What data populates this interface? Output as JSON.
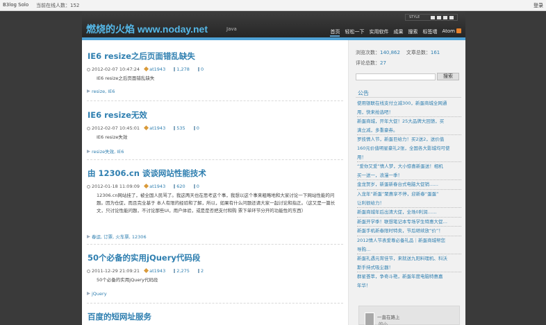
{
  "topbar": {
    "brand": "B3log Solo",
    "online": "当前在线人数：152",
    "login": "登录"
  },
  "header": {
    "title": "燃烧的火焰 www.noday.net",
    "subtitle": "Java",
    "style_label": "STYLE",
    "nav": [
      "首页",
      "轻松一下",
      "实用软件",
      "成果",
      "搜索",
      "标签墙",
      "Atom"
    ]
  },
  "posts": [
    {
      "title": "IE6 resize之后页面错乱缺失",
      "date": "2012-02-07 10:47:24",
      "author": "at1943",
      "views": "1,278",
      "comments": "0",
      "abstract": "IE6 resize之后页面错乱缺失",
      "tags": "resize, IE6"
    },
    {
      "title": "IE6 resize无效",
      "date": "2012-02-07 10:45:01",
      "author": "at1943",
      "views": "535",
      "comments": "0",
      "abstract": "IE6 resize失效",
      "tags": "resize失效, IE6"
    },
    {
      "title": "由 12306.cn 谈谈网站性能技术",
      "date": "2012-01-18 11:09:09",
      "author": "at1943",
      "views": "620",
      "comments": "0",
      "abstract": "12306.cn网站挂了，被全国人民骂了。我这两天也在思考这个事，我想以这个事来粗略地和大家讨论一下网站性能的问题。因为仓促，而且完全基于 本人有限的经验和了解，所以，如果有什么问题还请大家一起讨论和指正。（这又是一篇长文，只讨论性能问题，不讨论那些UI，用户体验，或是是否把支付和购 票下单环节分开的功能性的东西）",
      "tags": "春运, 订票, 火车票, 12306"
    },
    {
      "title": "50个必备的实用jQuery代码段",
      "date": "2011-12-29 21:09:21",
      "author": "at1943",
      "views": "2,275",
      "comments": "2",
      "abstract": "50个必备的实用jQuery代码段",
      "tags": "jQuery"
    },
    {
      "title": "百度的短网址服务"
    }
  ],
  "sidebar": {
    "views_label": "浏览次数：",
    "views": "140,862",
    "articles_label": "文章总数：",
    "articles": "161",
    "comments_label": "评论总数：",
    "comments": "27",
    "search_button": "搜索",
    "notice_title": "公告",
    "notices": [
      "使用银联在线支付立减300，新蛋商城全网通",
      "用，快来抢选吧！",
      "新蛋商城，开年大促！25大品牌大回馈，买",
      "满立减，多重豪券。",
      "罗技情人节，新蛋巨给力！买2送2，送价值",
      "160元价值明星豪礼2张，全国各大影城均可使",
      "用！",
      "“爱你又爱”情人梦，大小惊喜新蛋送！相机",
      "买一送一，浪漫一季！",
      "金龙贺岁，新蛋新春台式电脑大促销……",
      "入龙年“新蛋”聚惠享不停，迎新春“蛋蛋”",
      "让利很给力！",
      "新蛋商城年后出清大促，全场0利润……",
      "新蛋开学季！联想笔记本专场学生特惠大促…",
      "新蛋手机新春限时特卖，节后继续放“价”！",
      "2012情人节表爱尊必备礼品｜新蛋商城帮您",
      "导购…",
      "新蛋礼遇元宵佳节，来就送九阳料理机、科沃",
      "斯手持式吸尘器！",
      "群星荟萃，争奇斗艳，新蛋年度电脑特惠嘉",
      "年华！"
    ],
    "card_name": "一直在路上",
    "card_sub": "的小"
  }
}
